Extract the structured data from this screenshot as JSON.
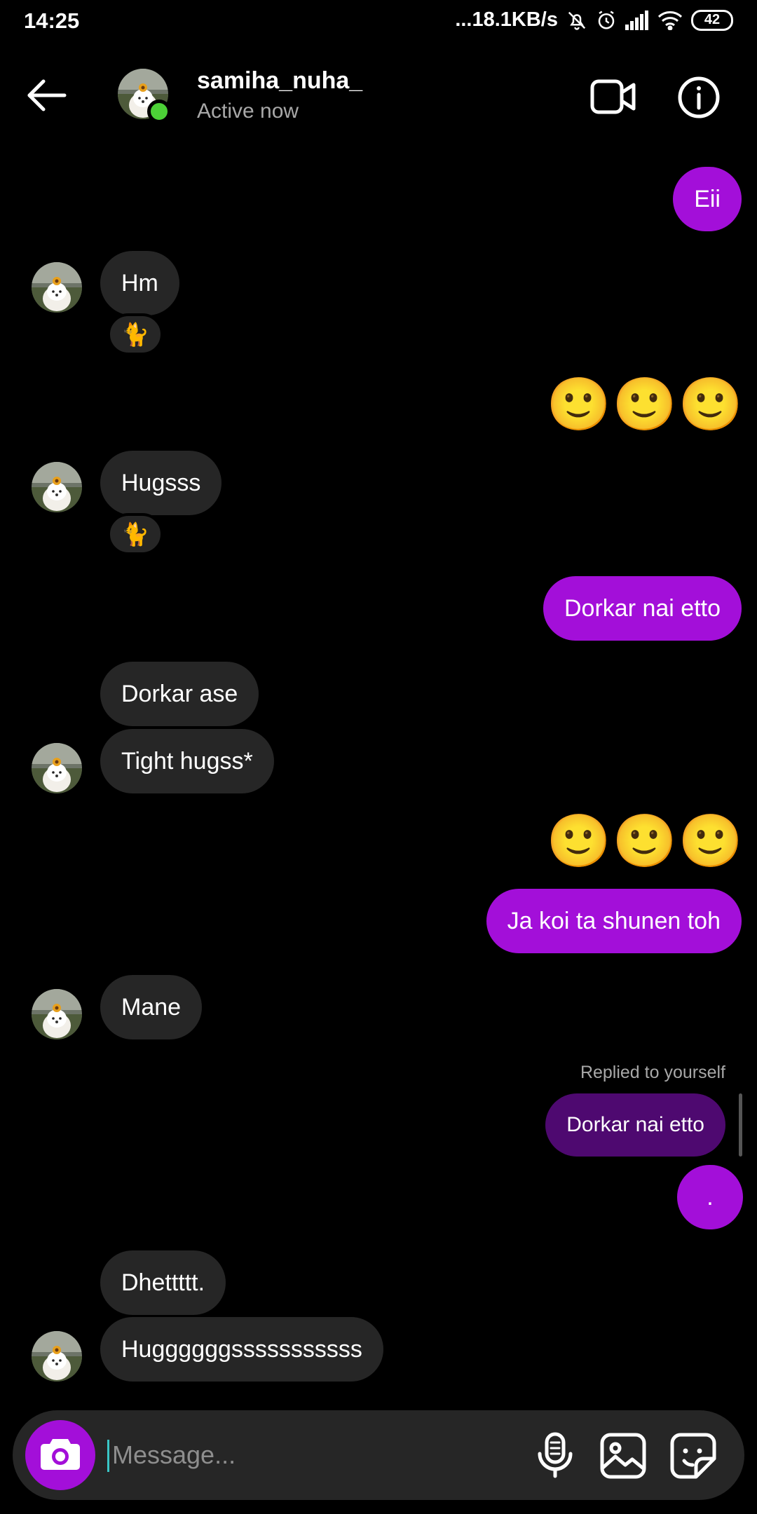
{
  "status_bar": {
    "time": "14:25",
    "network_speed": "...18.1KB/s",
    "battery": "42",
    "icons": [
      "bell-off-icon",
      "alarm-icon",
      "signal-icon",
      "wifi-icon",
      "battery-icon"
    ]
  },
  "header": {
    "username": "samiha_nuha_",
    "status": "Active now",
    "online_color": "#4cd137"
  },
  "messages": {
    "m1": "Eii",
    "m2": "Hm",
    "m2_reaction": "🐈",
    "m3": "🙂🙂🙂",
    "m4": "Hugsss",
    "m4_reaction": "🐈",
    "m5": "Dorkar nai etto",
    "m6": "Dorkar ase",
    "m7": "Tight hugss*",
    "m8": "🙂🙂🙂",
    "m9": "Ja koi ta shunen toh",
    "m10": "Mane",
    "m11_label": "Replied to yourself",
    "m11": "Dorkar nai etto",
    "m12": ".",
    "m13": "Dhettttt.",
    "m14": "Huggggggsssssssssss"
  },
  "composer": {
    "placeholder": "Message..."
  },
  "colors": {
    "outgoing_bubble": "#a30fd9",
    "incoming_bubble": "#262626",
    "reply_bubble": "#4e0970",
    "background": "#000000"
  }
}
